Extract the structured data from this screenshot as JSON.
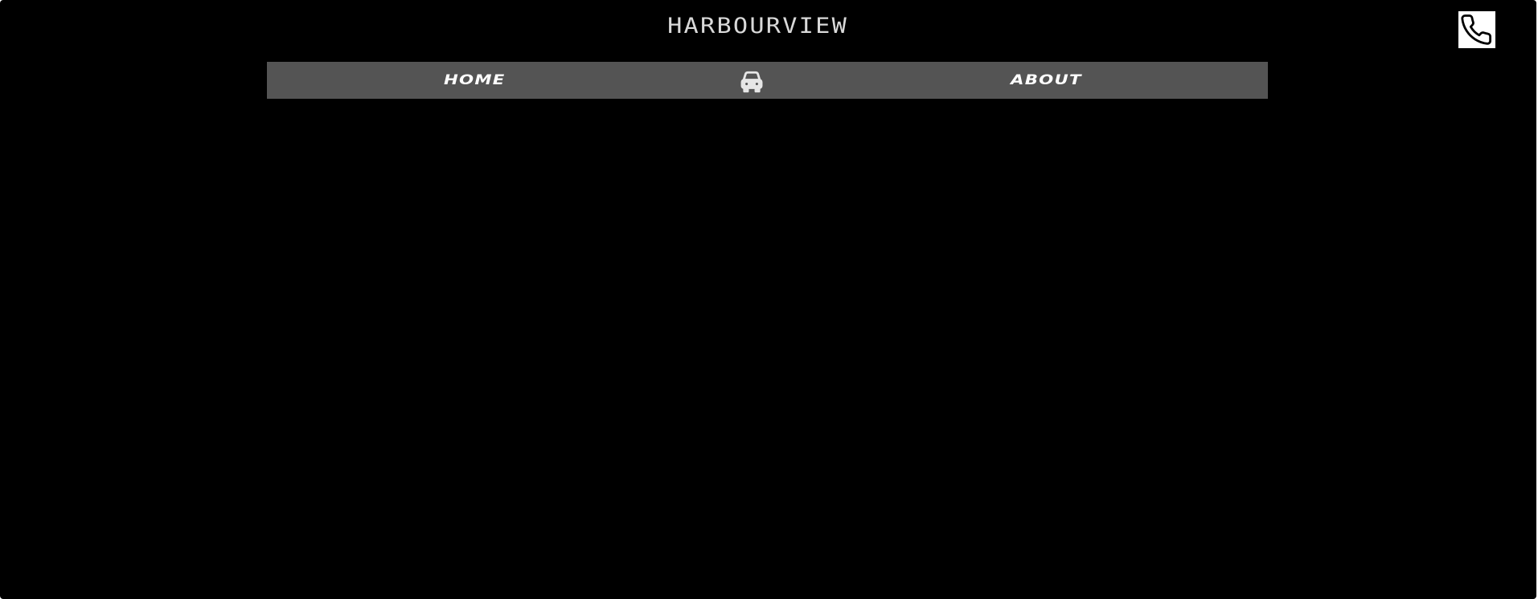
{
  "header": {
    "site_title": "HARBOURVIEW",
    "phone_icon": "phone-icon"
  },
  "navbar": {
    "items": [
      {
        "label": "HOME"
      },
      {
        "icon": "car-icon"
      },
      {
        "label": "ABOUT"
      }
    ]
  },
  "colors": {
    "background": "#000000",
    "navbar": "#545454",
    "title_text": "#d9d9d9",
    "nav_text": "#ffffff",
    "phone_button_bg": "#ffffff"
  }
}
